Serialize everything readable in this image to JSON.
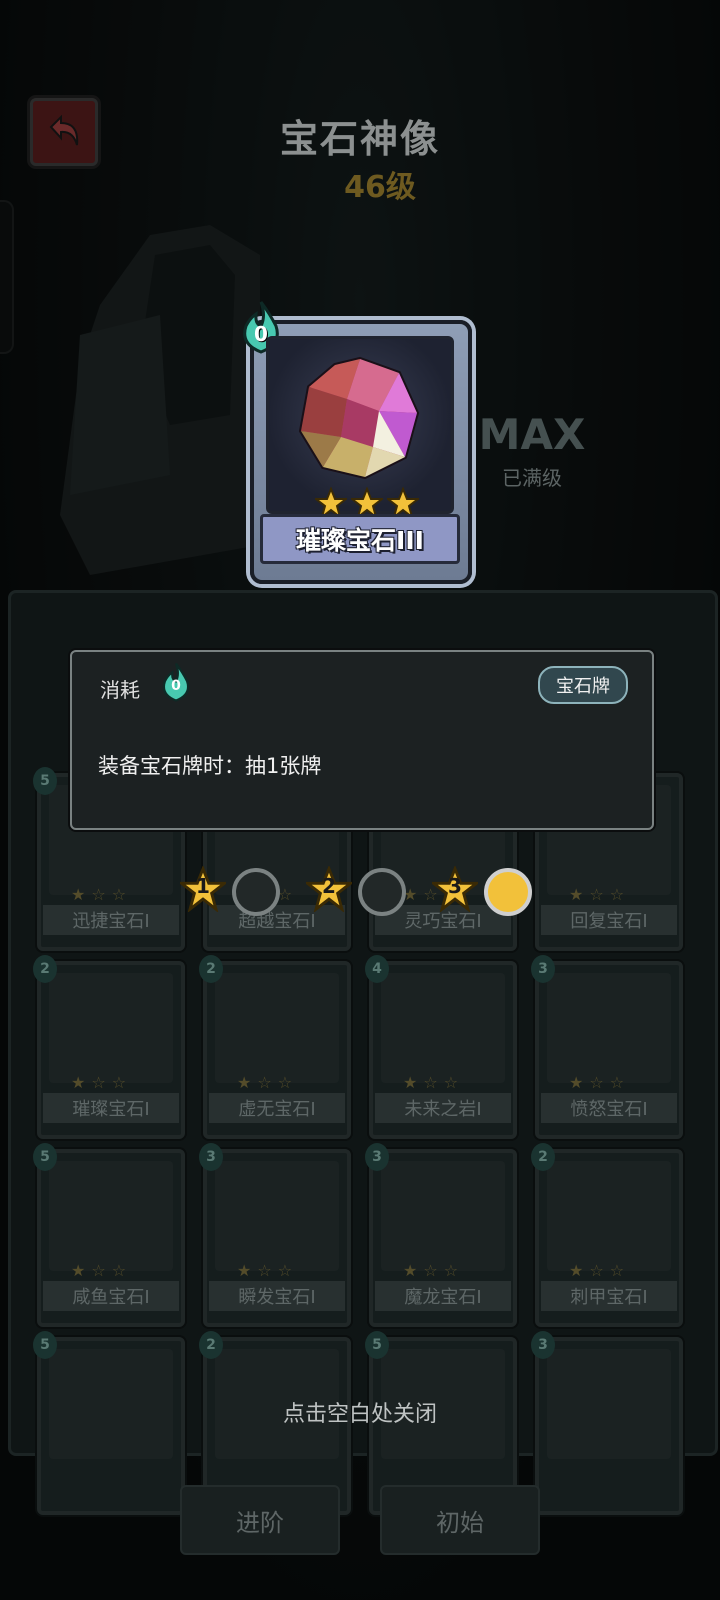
{
  "header": {
    "title": "宝石神像",
    "level": "46级",
    "max_text": "MAX",
    "maxed_text": "已满级"
  },
  "main_card": {
    "name": "璀璨宝石III",
    "cost": "0",
    "stars": 3
  },
  "grid": {
    "cards": [
      {
        "name": "迅捷宝石I",
        "cost": "5",
        "stars": 1
      },
      {
        "name": "超越宝石I",
        "cost": "",
        "stars": 1
      },
      {
        "name": "灵巧宝石I",
        "cost": "",
        "stars": 1
      },
      {
        "name": "回复宝石I",
        "cost": "",
        "stars": 1
      },
      {
        "name": "璀璨宝石I",
        "cost": "2",
        "stars": 1
      },
      {
        "name": "虚无宝石I",
        "cost": "2",
        "stars": 1
      },
      {
        "name": "未来之岩I",
        "cost": "4",
        "stars": 1
      },
      {
        "name": "愤怒宝石I",
        "cost": "3",
        "stars": 1
      },
      {
        "name": "咸鱼宝石I",
        "cost": "5",
        "stars": 1
      },
      {
        "name": "瞬发宝石I",
        "cost": "3",
        "stars": 1
      },
      {
        "name": "魔龙宝石I",
        "cost": "3",
        "stars": 1
      },
      {
        "name": "刺甲宝石I",
        "cost": "2",
        "stars": 1
      },
      {
        "name": "",
        "cost": "5",
        "stars": 0
      },
      {
        "name": "",
        "cost": "2",
        "stars": 0
      },
      {
        "name": "",
        "cost": "5",
        "stars": 0
      },
      {
        "name": "",
        "cost": "3",
        "stars": 0
      }
    ]
  },
  "tooltip": {
    "consume_label": "消耗",
    "cost": "0",
    "tag": "宝石牌",
    "description": "装备宝石牌时：抽1张牌"
  },
  "upgrade_steps": {
    "levels": [
      "1",
      "2",
      "3"
    ],
    "active_level": 3
  },
  "close_hint": "点击空白处关闭",
  "buttons": {
    "advance": "进阶",
    "reset": "初始"
  },
  "colors": {
    "star_gold": "#f2c13a",
    "tooltip_bg": "#1c2122",
    "tag_bg": "#31474e",
    "card_frame": "#8f9eb6",
    "cost_teal": "#48c9b0"
  },
  "icons": {
    "back": "back-arrow-icon",
    "cost": "blue-flame-icon",
    "star": "star-icon"
  }
}
